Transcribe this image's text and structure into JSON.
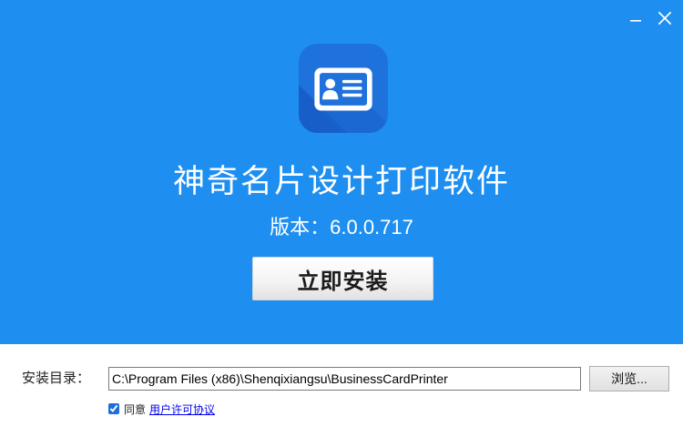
{
  "icons": {
    "minimize": "minimize-icon",
    "close": "close-icon",
    "app": "id-card-icon"
  },
  "colors": {
    "header_bg": "#1E8FF0",
    "icon_bg": "#1F72DC",
    "link": "#0000EE"
  },
  "app": {
    "title": "神奇名片设计打印软件",
    "version_label": "版本：",
    "version": "6.0.0.717"
  },
  "install_button": {
    "label": "立即安装"
  },
  "install_dir": {
    "label": "安装目录：",
    "path": "C:\\Program Files (x86)\\Shenqixiangsu\\BusinessCardPrinter",
    "browse_label": "浏览..."
  },
  "agreement": {
    "checked": true,
    "label": "同意",
    "link_text": "用户许可协议"
  }
}
